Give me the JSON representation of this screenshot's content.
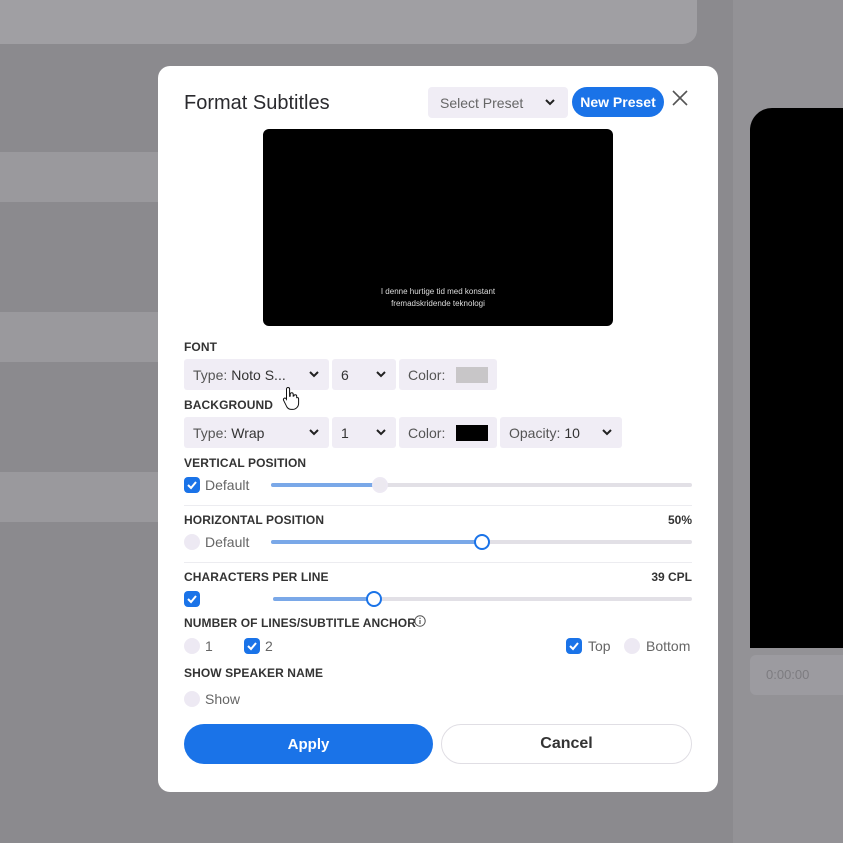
{
  "dialog": {
    "title": "Format Subtitles",
    "preset_placeholder": "Select Preset",
    "new_preset_label": "New Preset"
  },
  "preview": {
    "line1": "I denne hurtige tid med konstant",
    "line2": "fremadskridende teknologi"
  },
  "font": {
    "label": "FONT",
    "type_label": "Type:",
    "type_value": "Noto S...",
    "size_value": "6",
    "color_label": "Color:",
    "color_value": "#c8c6c8"
  },
  "background": {
    "label": "BACKGROUND",
    "type_label": "Type:",
    "type_value": "Wrap",
    "size_value": "1",
    "color_label": "Color:",
    "color_value": "#000000",
    "opacity_label": "Opacity:",
    "opacity_value": "10"
  },
  "vertical_position": {
    "label": "VERTICAL POSITION",
    "default_label": "Default",
    "default_checked": true,
    "slider_level": 0.26
  },
  "horizontal_position": {
    "label": "HORIZONTAL POSITION",
    "value": "50%",
    "default_label": "Default",
    "default_checked": false,
    "slider_level": 0.5
  },
  "characters_per_line": {
    "label": "CHARACTERS PER LINE",
    "value": "39 CPL",
    "checked": true,
    "slider_level": 0.24
  },
  "lines_anchor": {
    "label": "NUMBER OF LINES/SUBTITLE ANCHOR",
    "option_1": "1",
    "option_2": "2",
    "anchor_top": "Top",
    "anchor_bottom": "Bottom"
  },
  "speaker": {
    "label": "SHOW SPEAKER NAME",
    "show_label": "Show"
  },
  "actions": {
    "apply": "Apply",
    "cancel": "Cancel"
  },
  "backdrop": {
    "timecode": "0:00:00"
  },
  "colors": {
    "accent": "#1a73e8"
  }
}
